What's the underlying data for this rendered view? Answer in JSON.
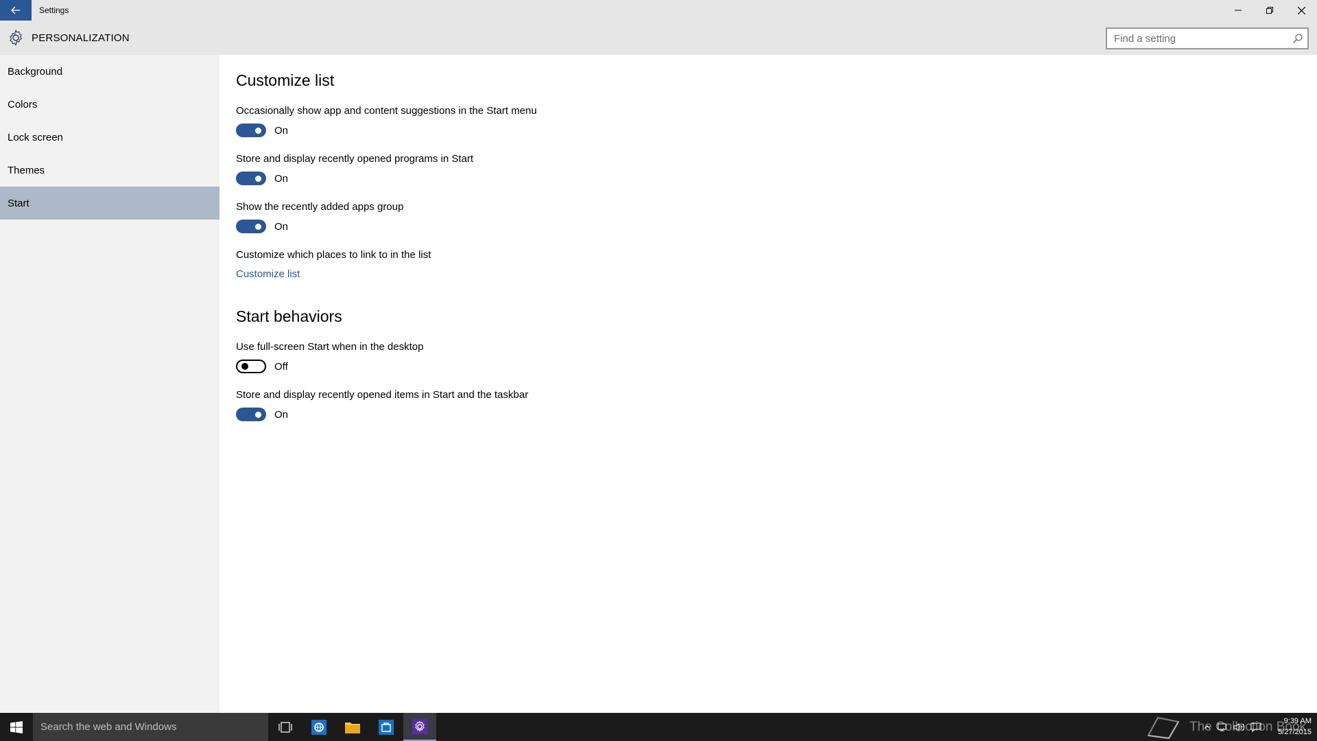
{
  "window": {
    "title": "Settings"
  },
  "header": {
    "section_title": "PERSONALIZATION",
    "search_placeholder": "Find a setting"
  },
  "sidebar": {
    "items": [
      {
        "label": "Background",
        "selected": false
      },
      {
        "label": "Colors",
        "selected": false
      },
      {
        "label": "Lock screen",
        "selected": false
      },
      {
        "label": "Themes",
        "selected": false
      },
      {
        "label": "Start",
        "selected": true
      }
    ]
  },
  "main": {
    "customize_heading": "Customize list",
    "settings": [
      {
        "label": "Occasionally show app and content suggestions in the Start menu",
        "state": "On",
        "on": true
      },
      {
        "label": "Store and display recently opened programs in Start",
        "state": "On",
        "on": true
      },
      {
        "label": "Show the recently added apps group",
        "state": "On",
        "on": true
      }
    ],
    "places_label": "Customize which places to link to in the list",
    "places_link": "Customize list",
    "behaviors_heading": "Start behaviors",
    "behaviors": [
      {
        "label": "Use full-screen Start when in the desktop",
        "state": "Off",
        "on": false
      },
      {
        "label": "Store and display recently opened items in Start and the taskbar",
        "state": "On",
        "on": true
      }
    ]
  },
  "taskbar": {
    "search_placeholder": "Search the web and Windows",
    "watermark_text": "The Collection Book",
    "time": "9:39 AM",
    "date": "5/27/2015"
  },
  "colors": {
    "accent": "#2b5797",
    "sidebar_selected": "#adb8c8",
    "chrome": "#e6e6e6",
    "sidebar_bg": "#f2f2f2",
    "taskbar": "#1b1b1c"
  },
  "icons": [
    "back-arrow-icon",
    "gear-icon",
    "search-icon",
    "minimize-icon",
    "maximize-icon",
    "close-icon",
    "windows-logo-icon",
    "task-view-icon",
    "ie-icon",
    "file-explorer-icon",
    "store-icon",
    "settings-gear-icon",
    "book-icon",
    "chevron-up-icon",
    "network-icon",
    "volume-icon",
    "action-center-icon"
  ]
}
